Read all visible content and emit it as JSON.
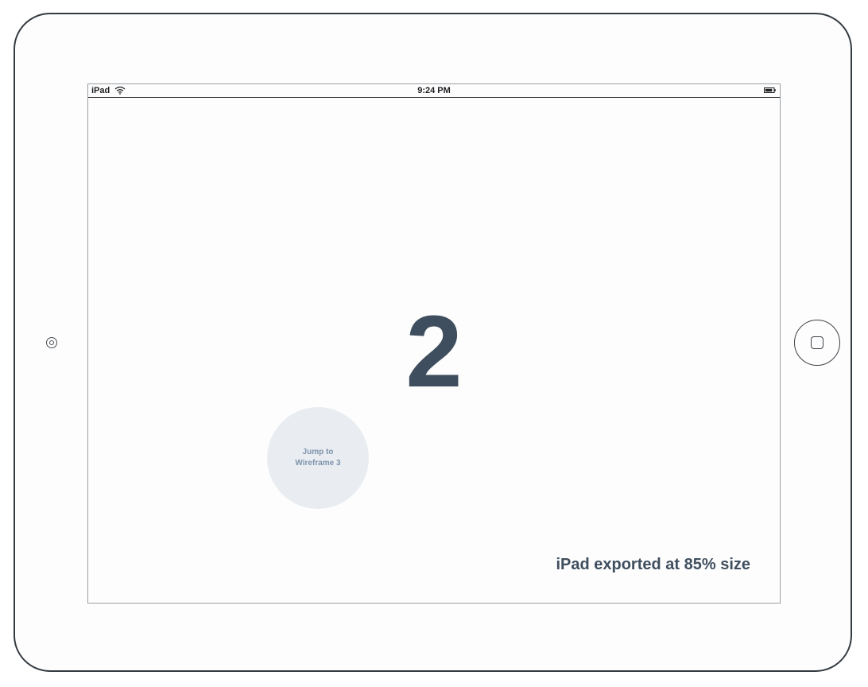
{
  "status_bar": {
    "carrier": "iPad",
    "time": "9:24 PM",
    "icons": [
      "wifi-icon",
      "battery-icon"
    ]
  },
  "main": {
    "big_number": "2",
    "jump_button": {
      "line1": "Jump to",
      "line2": "Wireframe 3"
    },
    "export_note": "iPad exported at 85% size"
  },
  "device": {
    "icons": [
      "camera-icon",
      "home-button"
    ]
  },
  "colors": {
    "text_dark": "#3f4e5e",
    "button_bg": "#e9edf2",
    "button_text": "#7e93ac"
  }
}
